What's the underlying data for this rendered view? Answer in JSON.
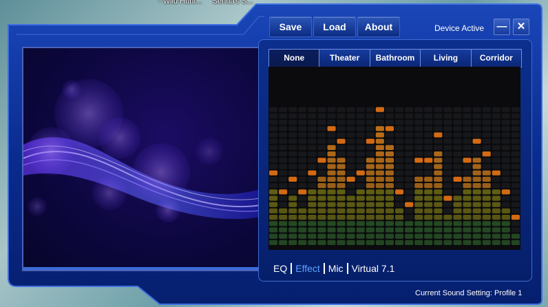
{
  "desktop": {
    "taskbar_titles": [
      "- Wild Hunt...",
      "Senua's S..."
    ]
  },
  "toolbar": {
    "save_label": "Save",
    "load_label": "Load",
    "about_label": "About"
  },
  "status": {
    "device": "Device Active"
  },
  "window_controls": {
    "minimize": "—",
    "close": "✕"
  },
  "presets": {
    "tabs": [
      "None",
      "Theater",
      "Bathroom",
      "Living Room",
      "Corridor"
    ],
    "selected": "None"
  },
  "modes": {
    "items": [
      "EQ",
      "Effect",
      "Mic",
      "Virtual 7.1"
    ],
    "selected": "Effect"
  },
  "footer": {
    "current_setting": "Current Sound Setting: Profile 1"
  },
  "visualizer": {
    "bar_levels": [
      10,
      7,
      9,
      7,
      10,
      12,
      17,
      15,
      9,
      10,
      15,
      20,
      17,
      7,
      5,
      12,
      12,
      16,
      6,
      9,
      12,
      15,
      13,
      10,
      7,
      3
    ],
    "max_level": 22,
    "colors": {
      "low": "#2e6b28",
      "mid": "#7d7a10",
      "high": "#c9781a",
      "peak": "#d36a14"
    }
  },
  "accent_color": "#0a2a86"
}
